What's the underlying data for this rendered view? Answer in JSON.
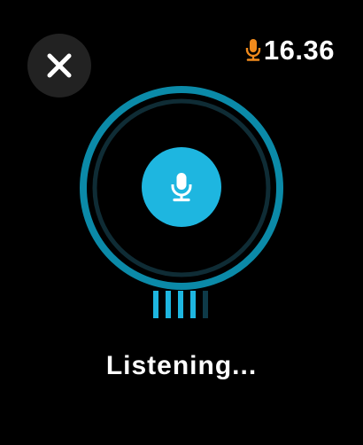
{
  "header": {
    "close_icon": "close-icon",
    "recording_icon": "microphone-icon",
    "recording_icon_color": "#f08a1c",
    "time": "16.36"
  },
  "voice_input": {
    "mic_icon": "microphone-icon",
    "accent_color": "#1eb6e0",
    "level": {
      "active_bars": 4,
      "total_bars": 5
    },
    "status_text": "Listening..."
  }
}
